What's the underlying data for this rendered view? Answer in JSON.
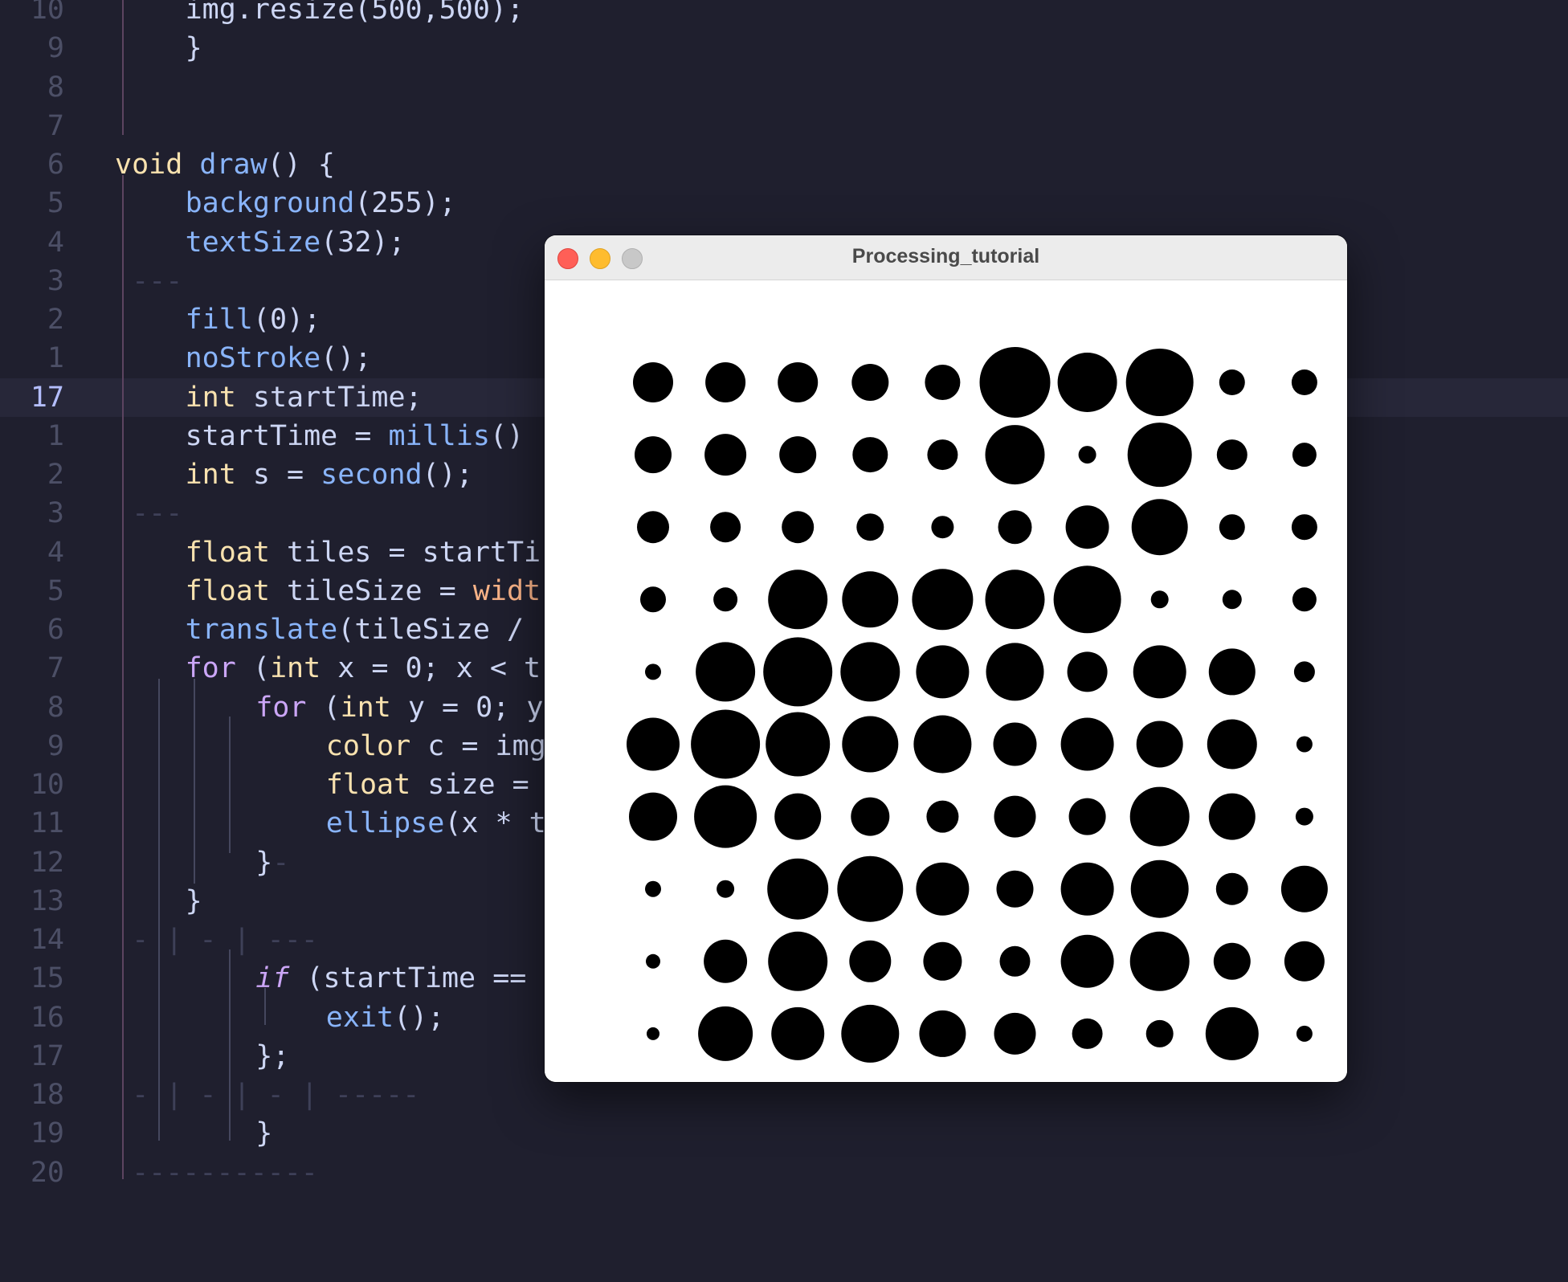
{
  "editor": {
    "active_line_number": "17",
    "lines": [
      {
        "num": "10",
        "indent": 2,
        "tokens": [
          {
            "t": "img.resize(500,500);"
          }
        ]
      },
      {
        "num": "9",
        "indent": 2,
        "tokens": [
          {
            "t": "}"
          }
        ]
      },
      {
        "num": "8",
        "indent": 0,
        "tokens": []
      },
      {
        "num": "7",
        "indent": 0,
        "tokens": []
      },
      {
        "num": "6",
        "indent": 0,
        "tokens": [
          {
            "t": "void",
            "c": "t-kw"
          },
          {
            "t": " "
          },
          {
            "t": "draw",
            "c": "t-fn"
          },
          {
            "t": "() {"
          }
        ]
      },
      {
        "num": "5",
        "indent": 2,
        "tokens": [
          {
            "t": "background",
            "c": "t-fn"
          },
          {
            "t": "(255);"
          }
        ]
      },
      {
        "num": "4",
        "indent": 2,
        "tokens": [
          {
            "t": "textSize",
            "c": "t-fn"
          },
          {
            "t": "(32);"
          }
        ]
      },
      {
        "num": "3",
        "indent": 0,
        "tokens": [
          {
            "t": " ---",
            "c": "t-dash"
          }
        ]
      },
      {
        "num": "2",
        "indent": 2,
        "tokens": [
          {
            "t": "fill",
            "c": "t-fn"
          },
          {
            "t": "(0);"
          }
        ]
      },
      {
        "num": "1",
        "indent": 2,
        "tokens": [
          {
            "t": "noStroke",
            "c": "t-fn"
          },
          {
            "t": "();"
          }
        ]
      },
      {
        "num": "17",
        "indent": 2,
        "active": true,
        "tokens": [
          {
            "t": "int",
            "c": "t-kw"
          },
          {
            "t": " startTime;"
          }
        ]
      },
      {
        "num": "1",
        "indent": 2,
        "tokens": [
          {
            "t": "startTime = "
          },
          {
            "t": "millis",
            "c": "t-fn"
          },
          {
            "t": "()"
          }
        ]
      },
      {
        "num": "2",
        "indent": 2,
        "tokens": [
          {
            "t": "int",
            "c": "t-kw"
          },
          {
            "t": " s = "
          },
          {
            "t": "second",
            "c": "t-fn"
          },
          {
            "t": "();"
          }
        ]
      },
      {
        "num": "3",
        "indent": 0,
        "tokens": [
          {
            "t": " ---",
            "c": "t-dash"
          }
        ]
      },
      {
        "num": "4",
        "indent": 2,
        "tokens": [
          {
            "t": "float",
            "c": "t-kw"
          },
          {
            "t": " tiles = startTi"
          }
        ]
      },
      {
        "num": "5",
        "indent": 2,
        "tokens": [
          {
            "t": "float",
            "c": "t-kw"
          },
          {
            "t": " tileSize = "
          },
          {
            "t": "widt",
            "c": "t-orange"
          }
        ]
      },
      {
        "num": "6",
        "indent": 2,
        "tokens": [
          {
            "t": "translate",
            "c": "t-fn"
          },
          {
            "t": "(tileSize /"
          }
        ]
      },
      {
        "num": "7",
        "indent": 2,
        "tokens": [
          {
            "t": "for",
            "c": "t-ctl"
          },
          {
            "t": " ("
          },
          {
            "t": "int",
            "c": "t-kw"
          },
          {
            "t": " x = 0; x < t"
          }
        ]
      },
      {
        "num": "8",
        "indent": 4,
        "tokens": [
          {
            "t": "for",
            "c": "t-ctl"
          },
          {
            "t": " ("
          },
          {
            "t": "int",
            "c": "t-kw"
          },
          {
            "t": " y = 0; y"
          }
        ]
      },
      {
        "num": "9",
        "indent": 6,
        "tokens": [
          {
            "t": "color",
            "c": "t-kw"
          },
          {
            "t": " c = img"
          }
        ]
      },
      {
        "num": "10",
        "indent": 6,
        "tokens": [
          {
            "t": "float",
            "c": "t-kw"
          },
          {
            "t": " size ="
          }
        ]
      },
      {
        "num": "11",
        "indent": 6,
        "tokens": [
          {
            "t": "ellipse",
            "c": "t-fn"
          },
          {
            "t": "(x * t"
          }
        ]
      },
      {
        "num": "12",
        "indent": 4,
        "tokens": [
          {
            "t": "}"
          },
          {
            "t": "-",
            "c": "t-dash"
          }
        ]
      },
      {
        "num": "13",
        "indent": 2,
        "tokens": [
          {
            "t": "}"
          }
        ]
      },
      {
        "num": "14",
        "indent": 0,
        "tokens": [
          {
            "t": " - | - | ---",
            "c": "t-dash"
          }
        ]
      },
      {
        "num": "15",
        "indent": 4,
        "tokens": [
          {
            "t": "if",
            "c": "t-ctl t-it"
          },
          {
            "t": " (startTime =="
          }
        ]
      },
      {
        "num": "16",
        "indent": 6,
        "tokens": [
          {
            "t": "exit",
            "c": "t-fn"
          },
          {
            "t": "();"
          }
        ]
      },
      {
        "num": "17",
        "indent": 4,
        "tokens": [
          {
            "t": "};"
          }
        ]
      },
      {
        "num": "18",
        "indent": 0,
        "tokens": [
          {
            "t": " - | - | - | -----",
            "c": "t-dash"
          }
        ]
      },
      {
        "num": "19",
        "indent": 4,
        "tokens": [
          {
            "t": "}"
          }
        ]
      },
      {
        "num": "20",
        "indent": 0,
        "tokens": [
          {
            "t": " -----------",
            "c": "t-dash"
          }
        ]
      }
    ]
  },
  "sketch_window": {
    "title": "Processing_tutorial",
    "close_color": "#ff5f57",
    "minimize_color": "#febc2e",
    "maximize_color": "#c8c8c8",
    "dot_color": "#000000",
    "canvas_background": "#ffffff",
    "grid": {
      "columns": 10,
      "rows": 10,
      "diameters": [
        [
          50,
          50,
          50,
          46,
          44,
          88,
          74,
          84,
          32,
          32
        ],
        [
          46,
          52,
          46,
          44,
          38,
          74,
          22,
          80,
          38,
          30
        ],
        [
          40,
          38,
          40,
          34,
          28,
          42,
          54,
          70,
          32,
          32
        ],
        [
          32,
          30,
          74,
          70,
          76,
          74,
          84,
          22,
          24,
          30
        ],
        [
          20,
          74,
          86,
          74,
          66,
          72,
          50,
          66,
          58,
          26
        ],
        [
          66,
          86,
          80,
          70,
          72,
          54,
          66,
          58,
          62,
          20
        ],
        [
          60,
          78,
          58,
          48,
          40,
          52,
          46,
          74,
          58,
          22
        ],
        [
          20,
          22,
          76,
          82,
          66,
          46,
          66,
          72,
          40,
          58
        ],
        [
          18,
          54,
          74,
          52,
          48,
          38,
          66,
          74,
          46,
          50
        ],
        [
          16,
          68,
          66,
          72,
          58,
          52,
          38,
          34,
          66,
          20
        ]
      ]
    }
  }
}
